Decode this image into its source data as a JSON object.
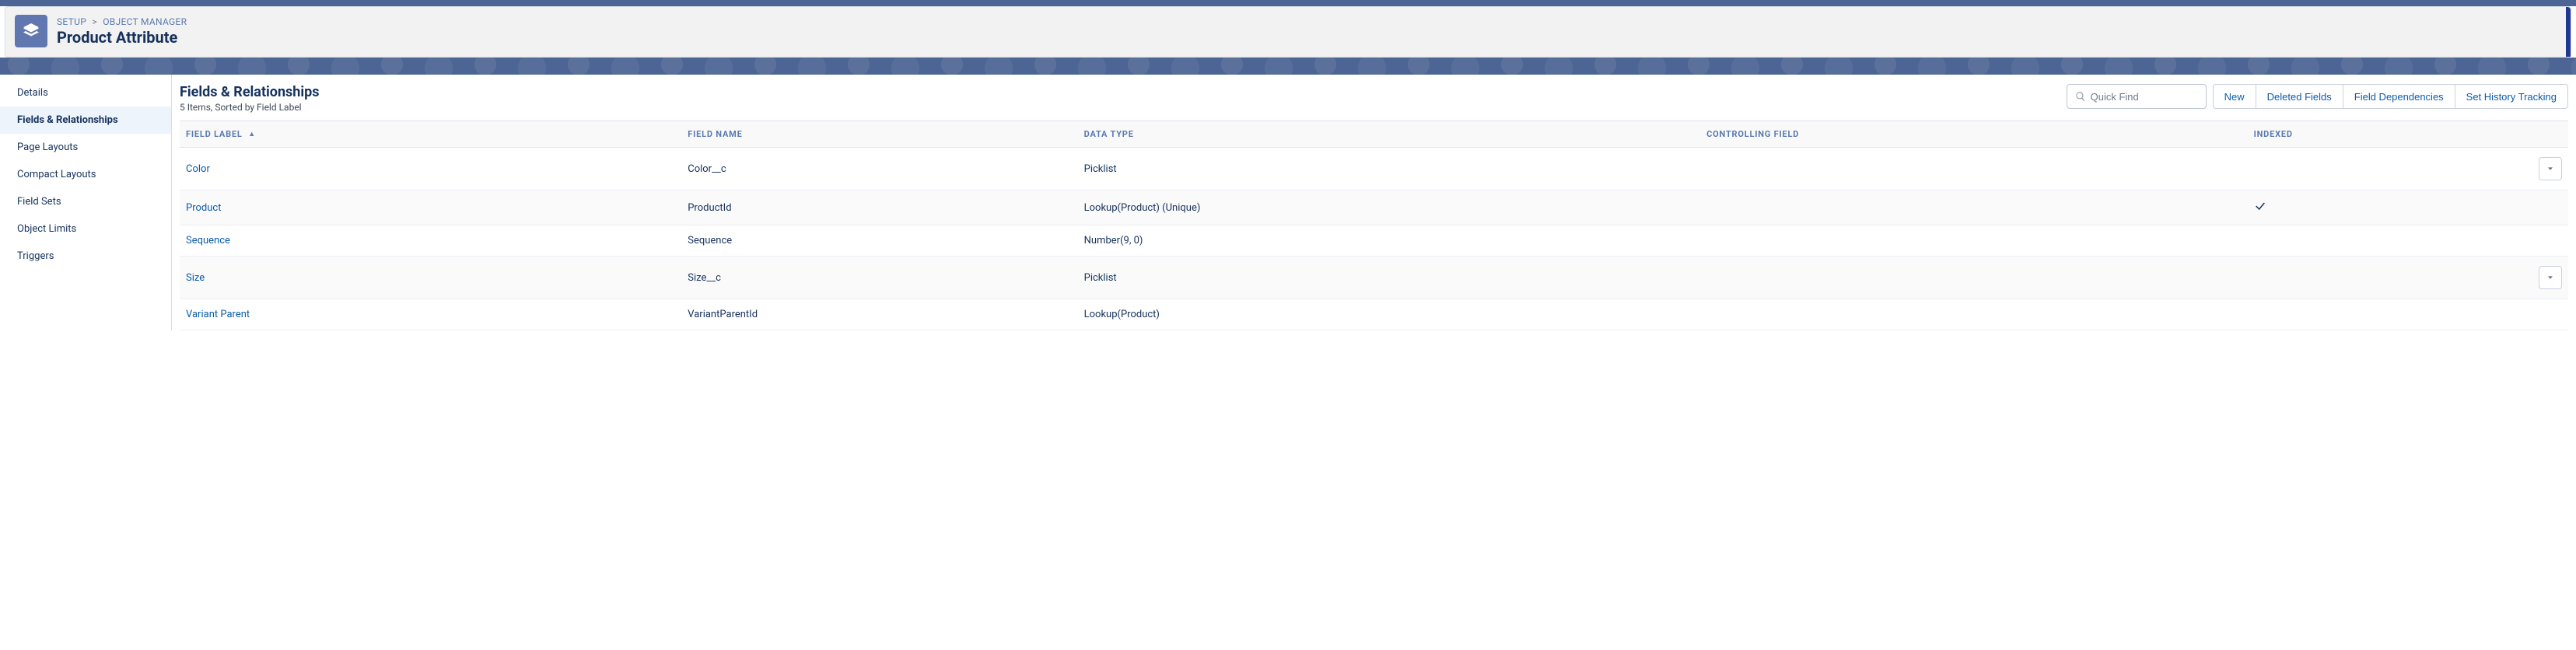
{
  "breadcrumb": {
    "item1": "SETUP",
    "item2": "OBJECT MANAGER"
  },
  "header": {
    "title": "Product Attribute"
  },
  "sidebar": {
    "items": [
      {
        "label": "Details",
        "active": false
      },
      {
        "label": "Fields & Relationships",
        "active": true
      },
      {
        "label": "Page Layouts",
        "active": false
      },
      {
        "label": "Compact Layouts",
        "active": false
      },
      {
        "label": "Field Sets",
        "active": false
      },
      {
        "label": "Object Limits",
        "active": false
      },
      {
        "label": "Triggers",
        "active": false
      }
    ]
  },
  "main": {
    "title": "Fields & Relationships",
    "subtitle": "5 Items, Sorted by Field Label"
  },
  "search": {
    "placeholder": "Quick Find"
  },
  "actions": {
    "new": "New",
    "deleted": "Deleted Fields",
    "dependencies": "Field Dependencies",
    "history": "Set History Tracking"
  },
  "columns": {
    "label": "FIELD LABEL",
    "name": "FIELD NAME",
    "type": "DATA TYPE",
    "controlling": "CONTROLLING FIELD",
    "indexed": "INDEXED"
  },
  "rows": [
    {
      "label": "Color",
      "name": "Color__c",
      "type": "Picklist",
      "controlling": "",
      "indexed": false,
      "actions": true
    },
    {
      "label": "Product",
      "name": "ProductId",
      "type": "Lookup(Product) (Unique)",
      "controlling": "",
      "indexed": true,
      "actions": false
    },
    {
      "label": "Sequence",
      "name": "Sequence",
      "type": "Number(9, 0)",
      "controlling": "",
      "indexed": false,
      "actions": false
    },
    {
      "label": "Size",
      "name": "Size__c",
      "type": "Picklist",
      "controlling": "",
      "indexed": false,
      "actions": true
    },
    {
      "label": "Variant Parent",
      "name": "VariantParentId",
      "type": "Lookup(Product)",
      "controlling": "",
      "indexed": false,
      "actions": false
    }
  ]
}
